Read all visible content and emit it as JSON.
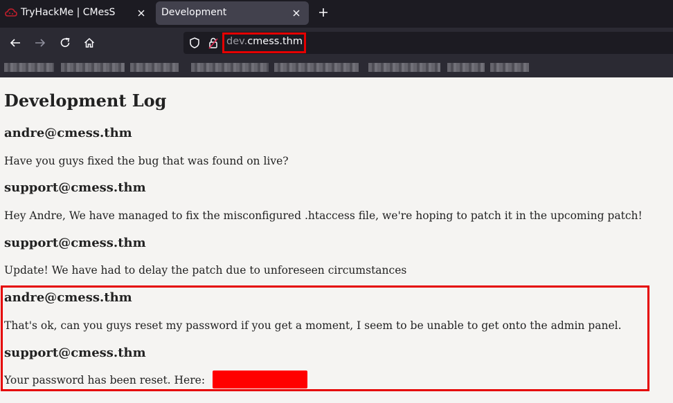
{
  "browser": {
    "tabs": [
      {
        "title": "TryHackMe | CMesS",
        "active": false,
        "favicon": "tryhackme-cloud-icon"
      },
      {
        "title": "Development",
        "active": true
      }
    ],
    "nav_icons": [
      "back-arrow-icon",
      "forward-arrow-icon",
      "reload-icon",
      "home-icon"
    ],
    "address": {
      "subdomain": "dev.",
      "domain": "cmess.thm",
      "icons": [
        "shield-icon",
        "lock-warning-icon"
      ]
    }
  },
  "page": {
    "title": "Development Log",
    "entries": [
      {
        "author": "andre@cmess.thm",
        "message": "Have you guys fixed the bug that was found on live?"
      },
      {
        "author": "support@cmess.thm",
        "message": "Hey Andre, We have managed to fix the misconfigured .htaccess file, we're hoping to patch it in the upcoming patch!"
      },
      {
        "author": "support@cmess.thm",
        "message": "Update! We have had to delay the patch due to unforeseen circumstances"
      },
      {
        "author": "andre@cmess.thm",
        "message": "That's ok, can you guys reset my password if you get a moment, I seem to be unable to get onto the admin panel."
      },
      {
        "author": "support@cmess.thm",
        "message": "Your password has been reset. Here:"
      }
    ]
  },
  "colors": {
    "highlight": "#e50000",
    "redaction": "#ff0000",
    "page_background": "#f5f4f2",
    "chrome_dark": "#1c1b22",
    "chrome_toolbar": "#2b2a33"
  }
}
